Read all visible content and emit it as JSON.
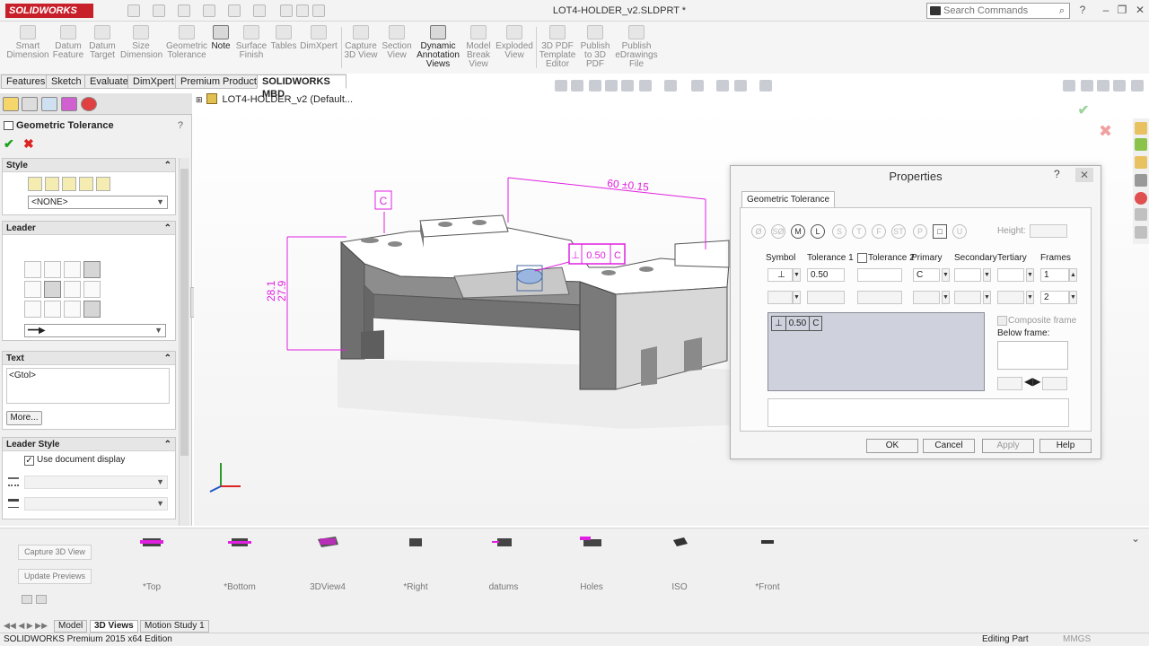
{
  "app": {
    "logo": "SOLIDWORKS",
    "document_title": "LOT4-HOLDER_v2.SLDPRT *",
    "search_placeholder": "Search Commands"
  },
  "commands": [
    {
      "label": "Smart Dimension",
      "icon": "smart-dimension-icon"
    },
    {
      "label": "Datum Feature",
      "icon": "datum-feature-icon"
    },
    {
      "label": "Datum Target",
      "icon": "datum-target-icon"
    },
    {
      "label": "Size Dimension",
      "icon": "size-dimension-icon"
    },
    {
      "label": "Geometric Tolerance",
      "icon": "geometric-tolerance-icon"
    },
    {
      "label": "Note",
      "icon": "note-icon"
    },
    {
      "label": "Surface Finish",
      "icon": "surface-finish-icon"
    },
    {
      "label": "Tables",
      "icon": "tables-icon"
    },
    {
      "label": "DimXpert",
      "icon": "dimxpert-icon"
    },
    {
      "label": "Capture 3D View",
      "icon": "capture-view-icon"
    },
    {
      "label": "Section View",
      "icon": "section-view-icon"
    },
    {
      "label": "Dynamic Annotation Views",
      "icon": "dynamic-annotation-icon"
    },
    {
      "label": "Model Break View",
      "icon": "model-break-icon"
    },
    {
      "label": "Exploded View",
      "icon": "exploded-view-icon"
    },
    {
      "label": "3D PDF Template Editor",
      "icon": "pdf-template-icon"
    },
    {
      "label": "Publish to 3D PDF",
      "icon": "publish-pdf-icon"
    },
    {
      "label": "Publish eDrawings File",
      "icon": "publish-edrawings-icon"
    }
  ],
  "tabs": [
    "Features",
    "Sketch",
    "Evaluate",
    "DimXpert",
    "Premium Products",
    "SOLIDWORKS MBD"
  ],
  "feature_tree": {
    "item": "LOT4-HOLDER_v2  (Default..."
  },
  "property_manager": {
    "title": "Geometric Tolerance",
    "help": "?",
    "style": {
      "header": "Style",
      "value": "<NONE>"
    },
    "leader": {
      "header": "Leader"
    },
    "text": {
      "header": "Text",
      "value": "<Gtol>",
      "more_button": "More..."
    },
    "leader_style": {
      "header": "Leader Style",
      "use_document_display": "Use document display"
    }
  },
  "annotations": {
    "datum_c": "C",
    "dim_width": "60 ±0.15",
    "dim_height_max": "28.1",
    "dim_height_min": "27.9",
    "gtol_value": "0.50",
    "gtol_datum": "C"
  },
  "properties_dialog": {
    "title": "Properties",
    "help": "?",
    "close": "✕",
    "tab": "Geometric Tolerance",
    "height_label": "Height:",
    "modifiers": [
      "Ø",
      "SØ",
      "M",
      "L",
      "S",
      "T",
      "F",
      "ST",
      "P",
      "□",
      "U"
    ],
    "headers": {
      "symbol": "Symbol",
      "tolerance1": "Tolerance 1",
      "tolerance2": "Tolerance 2",
      "primary": "Primary",
      "secondary": "Secondary",
      "tertiary": "Tertiary",
      "frames": "Frames"
    },
    "row1": {
      "symbol": "⊥",
      "tolerance1": "0.50",
      "primary": "C",
      "frames": "1"
    },
    "row2": {
      "frames": "2"
    },
    "preview": {
      "symbol": "⊥",
      "value": "0.50",
      "datum": "C"
    },
    "composite_frame": "Composite frame",
    "below_frame": "Below frame:",
    "buttons": {
      "ok": "OK",
      "cancel": "Cancel",
      "apply": "Apply",
      "help": "Help"
    }
  },
  "views_panel": {
    "capture_button": "Capture 3D View",
    "update_button": "Update Previews",
    "views": [
      "*Top",
      "*Bottom",
      "3DView4",
      "*Right",
      "datums",
      "Holes",
      "ISO",
      "*Front"
    ]
  },
  "bottom_tabs": [
    "Model",
    "3D Views",
    "Motion Study 1"
  ],
  "status": {
    "left": "SOLIDWORKS Premium 2015 x64 Edition",
    "right": "Editing Part",
    "units": "MMGS"
  },
  "colors": {
    "annotation": "#e020e0",
    "logo": "#c8202b",
    "ok": "#1aa31a",
    "cancel": "#d22222"
  }
}
